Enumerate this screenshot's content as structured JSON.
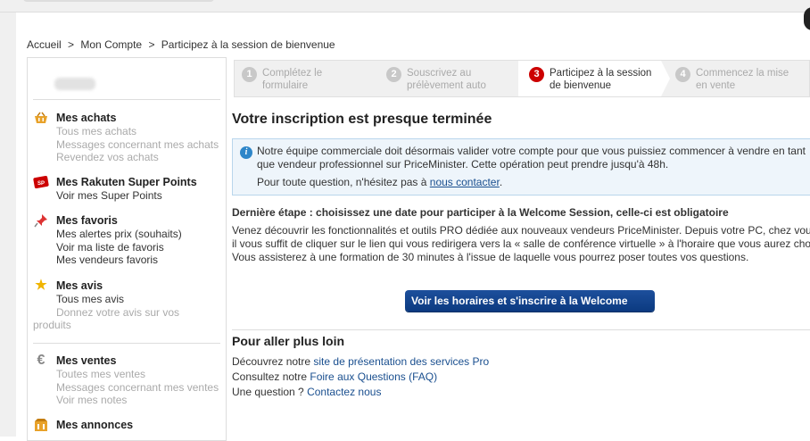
{
  "breadcrumb": {
    "items": [
      "Accueil",
      "Mon Compte",
      "Participez à la session de bienvenue"
    ],
    "separator": ">"
  },
  "sidebar": {
    "sections": [
      {
        "title": "Mes achats",
        "icon": "shopping-basket-icon",
        "links": [
          {
            "label": "Tous mes achats",
            "enabled": false
          },
          {
            "label": "Messages concernant mes achats",
            "enabled": false
          },
          {
            "label": "Revendez vos achats",
            "enabled": false
          }
        ]
      },
      {
        "title": "Mes Rakuten Super Points",
        "icon": "super-points-icon",
        "links": [
          {
            "label": "Voir mes Super Points",
            "enabled": true
          }
        ]
      },
      {
        "title": "Mes favoris",
        "icon": "pin-icon",
        "links": [
          {
            "label": "Mes alertes prix (souhaits)",
            "enabled": true
          },
          {
            "label": "Voir ma liste de favoris",
            "enabled": true
          },
          {
            "label": "Mes vendeurs favoris",
            "enabled": true
          }
        ]
      },
      {
        "title": "Mes avis",
        "icon": "star-icon",
        "links": [
          {
            "label": "Tous mes avis",
            "enabled": true
          },
          {
            "label": "Donnez votre avis sur vos produits",
            "enabled": false
          }
        ]
      },
      {
        "title": "Mes ventes",
        "icon": "euro-icon",
        "links": [
          {
            "label": "Toutes mes ventes",
            "enabled": false
          },
          {
            "label": "Messages concernant mes ventes",
            "enabled": false
          },
          {
            "label": "Voir mes notes",
            "enabled": false
          }
        ]
      },
      {
        "title": "Mes annonces",
        "icon": "announcements-icon",
        "links": []
      }
    ]
  },
  "steps": [
    {
      "num": "1",
      "line1": "Complétez le",
      "line2": "formulaire",
      "active": false
    },
    {
      "num": "2",
      "line1": "Souscrivez au",
      "line2": "prélèvement auto",
      "active": false
    },
    {
      "num": "3",
      "line1": "Participez à la session",
      "line2": "de bienvenue",
      "active": true
    },
    {
      "num": "4",
      "line1": "Commencez la mise",
      "line2": "en vente",
      "active": false
    }
  ],
  "main": {
    "title": "Votre inscription est presque terminée",
    "info": {
      "line1": "Notre équipe commerciale doit désormais valider votre compte pour que vous puissiez commencer à vendre en tant",
      "line2": "que vendeur professionnel sur PriceMinister. Cette opération peut prendre jusqu'à 48h.",
      "line3_prefix": "Pour toute question, n'hésitez pas à ",
      "line3_link": "nous contacter",
      "line3_suffix": "."
    },
    "last_step_heading": "Dernière étape : choisissez une date pour participer à la Welcome Session, celle-ci est obligatoire",
    "description": {
      "line1": "Venez découvrir les fonctionnalités et outils PRO dédiée aux nouveaux vendeurs PriceMinister. Depuis votre PC, chez vou",
      "line2": "il vous suffit de cliquer sur le lien qui vous redirigera vers la « salle de conférence virtuelle » à l'horaire que vous aurez cho",
      "line3": "Vous assisterez à une formation de 30 minutes à l'issue de laquelle vous pourrez poser toutes vos questions."
    },
    "cta_label": "Voir les horaires et s'inscrire à la Welcome",
    "more": {
      "title": "Pour aller plus loin",
      "line1_prefix": "Découvrez notre ",
      "line1_link": "site de présentation des services Pro",
      "line2_prefix": "Consultez notre ",
      "line2_link": "Foire aux Questions (FAQ)",
      "line3_prefix": "Une question ? ",
      "line3_link": "Contactez nous"
    }
  },
  "colors": {
    "accent": "#c00000",
    "link": "#1a4f8f",
    "button": "#0b3a80",
    "info_bg": "#eef5fb"
  }
}
